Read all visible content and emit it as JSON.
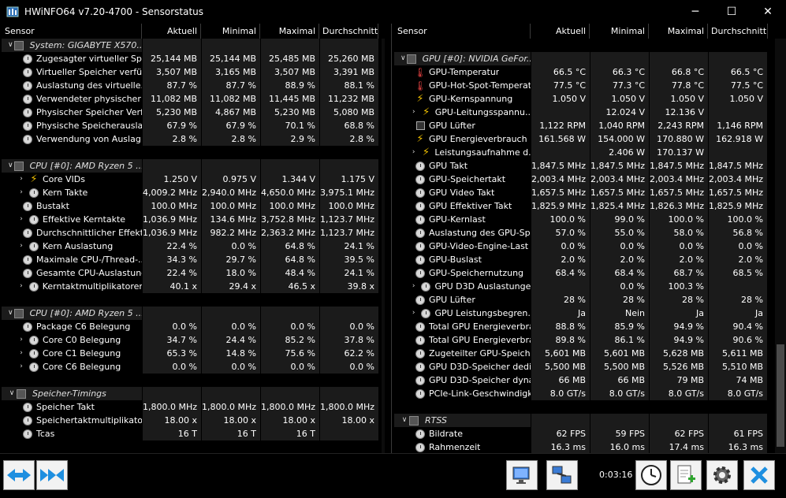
{
  "window": {
    "title": "HWiNFO64 v7.20-4700 - Sensorstatus",
    "minimize": "─",
    "maximize": "☐",
    "close": "✕"
  },
  "columns": {
    "sensor": "Sensor",
    "current": "Aktuell",
    "min": "Minimal",
    "max": "Maximal",
    "avg": "Durchschnitt"
  },
  "left_rows": [
    {
      "type": "group",
      "chev": "v",
      "name": "System: GIGABYTE X570..."
    },
    {
      "type": "item",
      "icon": "clock",
      "name": "Zugesagter virtueller Sp...",
      "cur": "25,144 MB",
      "min": "25,144 MB",
      "max": "25,485 MB",
      "avg": "25,260 MB"
    },
    {
      "type": "item",
      "icon": "clock",
      "name": "Virtueller Speicher verfü...",
      "cur": "3,507 MB",
      "min": "3,165 MB",
      "max": "3,507 MB",
      "avg": "3,391 MB"
    },
    {
      "type": "item",
      "icon": "clock",
      "name": "Auslastung des virtuelle...",
      "cur": "87.7 %",
      "min": "87.7 %",
      "max": "88.9 %",
      "avg": "88.1 %"
    },
    {
      "type": "item",
      "icon": "clock",
      "name": "Verwendeter physischer ...",
      "cur": "11,082 MB",
      "min": "11,082 MB",
      "max": "11,445 MB",
      "avg": "11,232 MB"
    },
    {
      "type": "item",
      "icon": "clock",
      "name": "Physischer Speicher Verf...",
      "cur": "5,230 MB",
      "min": "4,867 MB",
      "max": "5,230 MB",
      "avg": "5,080 MB"
    },
    {
      "type": "item",
      "icon": "clock",
      "name": "Physische Speicherausla...",
      "cur": "67.9 %",
      "min": "67.9 %",
      "max": "70.1 %",
      "avg": "68.8 %"
    },
    {
      "type": "item",
      "icon": "clock",
      "name": "Verwendung von Auslag...",
      "cur": "2.8 %",
      "min": "2.8 %",
      "max": "2.9 %",
      "avg": "2.8 %"
    },
    {
      "type": "blank"
    },
    {
      "type": "group",
      "chev": "v",
      "name": "CPU [#0]: AMD Ryzen 5 ..."
    },
    {
      "type": "sub",
      "chev": ">",
      "icon": "bolt",
      "name": "Core VIDs",
      "cur": "1.250 V",
      "min": "0.975 V",
      "max": "1.344 V",
      "avg": "1.175 V"
    },
    {
      "type": "sub",
      "chev": ">",
      "icon": "clock",
      "name": "Kern Takte",
      "cur": "4,009.2 MHz",
      "min": "2,940.0 MHz",
      "max": "4,650.0 MHz",
      "avg": "3,975.1 MHz"
    },
    {
      "type": "item",
      "icon": "clock",
      "name": "Bustakt",
      "cur": "100.0 MHz",
      "min": "100.0 MHz",
      "max": "100.0 MHz",
      "avg": "100.0 MHz"
    },
    {
      "type": "sub",
      "chev": ">",
      "icon": "clock",
      "name": "Effektive Kerntakte",
      "cur": "1,036.9 MHz",
      "min": "134.6 MHz",
      "max": "3,752.8 MHz",
      "avg": "1,123.7 MHz"
    },
    {
      "type": "item",
      "icon": "clock",
      "name": "Durchschnittlicher Effekti...",
      "cur": "1,036.9 MHz",
      "min": "982.2 MHz",
      "max": "2,363.2 MHz",
      "avg": "1,123.7 MHz"
    },
    {
      "type": "sub",
      "chev": ">",
      "icon": "clock",
      "name": "Kern Auslastung",
      "cur": "22.4 %",
      "min": "0.0 %",
      "max": "64.8 %",
      "avg": "24.1 %"
    },
    {
      "type": "item",
      "icon": "clock",
      "name": "Maximale CPU-/Thread-...",
      "cur": "34.3 %",
      "min": "29.7 %",
      "max": "64.8 %",
      "avg": "39.5 %"
    },
    {
      "type": "item",
      "icon": "clock",
      "name": "Gesamte CPU-Auslastung",
      "cur": "22.4 %",
      "min": "18.0 %",
      "max": "48.4 %",
      "avg": "24.1 %"
    },
    {
      "type": "sub",
      "chev": ">",
      "icon": "clock",
      "name": "Kerntaktmultiplikatoren",
      "cur": "40.1 x",
      "min": "29.4 x",
      "max": "46.5 x",
      "avg": "39.8 x"
    },
    {
      "type": "blank"
    },
    {
      "type": "group",
      "chev": "v",
      "name": "CPU [#0]: AMD Ryzen 5 ..."
    },
    {
      "type": "item",
      "icon": "clock",
      "name": "Package C6 Belegung",
      "cur": "0.0 %",
      "min": "0.0 %",
      "max": "0.0 %",
      "avg": "0.0 %"
    },
    {
      "type": "sub",
      "chev": ">",
      "icon": "clock",
      "name": "Core C0 Belegung",
      "cur": "34.7 %",
      "min": "24.4 %",
      "max": "85.2 %",
      "avg": "37.8 %"
    },
    {
      "type": "sub",
      "chev": ">",
      "icon": "clock",
      "name": "Core C1 Belegung",
      "cur": "65.3 %",
      "min": "14.8 %",
      "max": "75.6 %",
      "avg": "62.2 %"
    },
    {
      "type": "sub",
      "chev": ">",
      "icon": "clock",
      "name": "Core C6 Belegung",
      "cur": "0.0 %",
      "min": "0.0 %",
      "max": "0.0 %",
      "avg": "0.0 %"
    },
    {
      "type": "blank"
    },
    {
      "type": "group",
      "chev": "v",
      "name": "Speicher-Timings"
    },
    {
      "type": "item",
      "icon": "clock",
      "name": "Speicher Takt",
      "cur": "1,800.0 MHz",
      "min": "1,800.0 MHz",
      "max": "1,800.0 MHz",
      "avg": "1,800.0 MHz"
    },
    {
      "type": "item",
      "icon": "clock",
      "name": "Speichertaktmultiplikator",
      "cur": "18.00 x",
      "min": "18.00 x",
      "max": "18.00 x",
      "avg": "18.00 x"
    },
    {
      "type": "item",
      "icon": "clock",
      "name": "Tcas",
      "cur": "16 T",
      "min": "16 T",
      "max": "16 T",
      "avg": ""
    }
  ],
  "right_rows": [
    {
      "type": "blank"
    },
    {
      "type": "group",
      "chev": "v",
      "name": "GPU [#0]: NVIDIA GeFor..."
    },
    {
      "type": "item",
      "icon": "therm",
      "name": "GPU-Temperatur",
      "cur": "66.5 °C",
      "min": "66.3 °C",
      "max": "66.8 °C",
      "avg": "66.5 °C"
    },
    {
      "type": "item",
      "icon": "therm",
      "name": "GPU-Hot-Spot-Temperatur",
      "cur": "77.5 °C",
      "min": "77.3 °C",
      "max": "77.8 °C",
      "avg": "77.5 °C"
    },
    {
      "type": "item",
      "icon": "bolt",
      "name": "GPU-Kernspannung",
      "cur": "1.050 V",
      "min": "1.050 V",
      "max": "1.050 V",
      "avg": "1.050 V"
    },
    {
      "type": "sub",
      "chev": ">",
      "icon": "bolt",
      "name": "GPU-Leitungsspannu...",
      "cur": "",
      "min": "12.024 V",
      "max": "12.136 V",
      "avg": ""
    },
    {
      "type": "item",
      "icon": "chip",
      "name": "GPU Lüfter",
      "cur": "1,122 RPM",
      "min": "1,040 RPM",
      "max": "2,243 RPM",
      "avg": "1,146 RPM"
    },
    {
      "type": "item",
      "icon": "bolt",
      "name": "GPU Energieverbrauch",
      "cur": "161.568 W",
      "min": "154.000 W",
      "max": "170.880 W",
      "avg": "162.918 W"
    },
    {
      "type": "sub",
      "chev": ">",
      "icon": "bolt",
      "name": "Leistungsaufnahme d...",
      "cur": "",
      "min": "2.406 W",
      "max": "170.137 W",
      "avg": ""
    },
    {
      "type": "item",
      "icon": "clock",
      "name": "GPU Takt",
      "cur": "1,847.5 MHz",
      "min": "1,847.5 MHz",
      "max": "1,847.5 MHz",
      "avg": "1,847.5 MHz"
    },
    {
      "type": "item",
      "icon": "clock",
      "name": "GPU-Speichertakt",
      "cur": "2,003.4 MHz",
      "min": "2,003.4 MHz",
      "max": "2,003.4 MHz",
      "avg": "2,003.4 MHz"
    },
    {
      "type": "item",
      "icon": "clock",
      "name": "GPU Video Takt",
      "cur": "1,657.5 MHz",
      "min": "1,657.5 MHz",
      "max": "1,657.5 MHz",
      "avg": "1,657.5 MHz"
    },
    {
      "type": "item",
      "icon": "clock",
      "name": "GPU Effektiver Takt",
      "cur": "1,825.9 MHz",
      "min": "1,825.4 MHz",
      "max": "1,826.3 MHz",
      "avg": "1,825.9 MHz"
    },
    {
      "type": "item",
      "icon": "clock",
      "name": "GPU-Kernlast",
      "cur": "100.0 %",
      "min": "99.0 %",
      "max": "100.0 %",
      "avg": "100.0 %"
    },
    {
      "type": "item",
      "icon": "clock",
      "name": "Auslastung des GPU-Spe...",
      "cur": "57.0 %",
      "min": "55.0 %",
      "max": "58.0 %",
      "avg": "56.8 %"
    },
    {
      "type": "item",
      "icon": "clock",
      "name": "GPU-Video-Engine-Last",
      "cur": "0.0 %",
      "min": "0.0 %",
      "max": "0.0 %",
      "avg": "0.0 %"
    },
    {
      "type": "item",
      "icon": "clock",
      "name": "GPU-Buslast",
      "cur": "2.0 %",
      "min": "2.0 %",
      "max": "2.0 %",
      "avg": "2.0 %"
    },
    {
      "type": "item",
      "icon": "clock",
      "name": "GPU-Speichernutzung",
      "cur": "68.4 %",
      "min": "68.4 %",
      "max": "68.7 %",
      "avg": "68.5 %"
    },
    {
      "type": "sub",
      "chev": ">",
      "icon": "clock",
      "name": "GPU D3D Auslastungen",
      "cur": "",
      "min": "0.0 %",
      "max": "100.3 %",
      "avg": ""
    },
    {
      "type": "item",
      "icon": "clock",
      "name": "GPU Lüfter",
      "cur": "28 %",
      "min": "28 %",
      "max": "28 %",
      "avg": "28 %"
    },
    {
      "type": "sub",
      "chev": ">",
      "icon": "clock",
      "name": "GPU Leistungsbegren...",
      "cur": "Ja",
      "min": "Nein",
      "max": "Ja",
      "avg": "Ja"
    },
    {
      "type": "item",
      "icon": "clock",
      "name": "Total GPU Energieverbra...",
      "cur": "88.8 %",
      "min": "85.9 %",
      "max": "94.9 %",
      "avg": "90.4 %"
    },
    {
      "type": "item",
      "icon": "clock",
      "name": "Total GPU Energieverbra...",
      "cur": "89.8 %",
      "min": "86.1 %",
      "max": "94.9 %",
      "avg": "90.6 %"
    },
    {
      "type": "item",
      "icon": "clock",
      "name": "Zugeteilter GPU-Speicher",
      "cur": "5,601 MB",
      "min": "5,601 MB",
      "max": "5,628 MB",
      "avg": "5,611 MB"
    },
    {
      "type": "item",
      "icon": "clock",
      "name": "GPU D3D-Speicher dedizi...",
      "cur": "5,500 MB",
      "min": "5,500 MB",
      "max": "5,526 MB",
      "avg": "5,510 MB"
    },
    {
      "type": "item",
      "icon": "clock",
      "name": "GPU D3D-Speicher dyna...",
      "cur": "66 MB",
      "min": "66 MB",
      "max": "79 MB",
      "avg": "74 MB"
    },
    {
      "type": "item",
      "icon": "clock",
      "name": "PCIe-Link-Geschwindigkeit",
      "cur": "8.0 GT/s",
      "min": "8.0 GT/s",
      "max": "8.0 GT/s",
      "avg": "8.0 GT/s"
    },
    {
      "type": "blank"
    },
    {
      "type": "group",
      "chev": "v",
      "name": "RTSS"
    },
    {
      "type": "item",
      "icon": "clock",
      "name": "Bildrate",
      "cur": "62 FPS",
      "min": "59 FPS",
      "max": "62 FPS",
      "avg": "61 FPS"
    },
    {
      "type": "item",
      "icon": "clock",
      "name": "Rahmenzeit",
      "cur": "16.3 ms",
      "min": "16.0 ms",
      "max": "17.4 ms",
      "avg": "16.3 ms"
    }
  ],
  "footer": {
    "timer": "0:03:16"
  },
  "icons": {
    "bolt_color": "#f0c000",
    "therm_color": "#e04040",
    "accent_blue": "#1e90ff"
  }
}
